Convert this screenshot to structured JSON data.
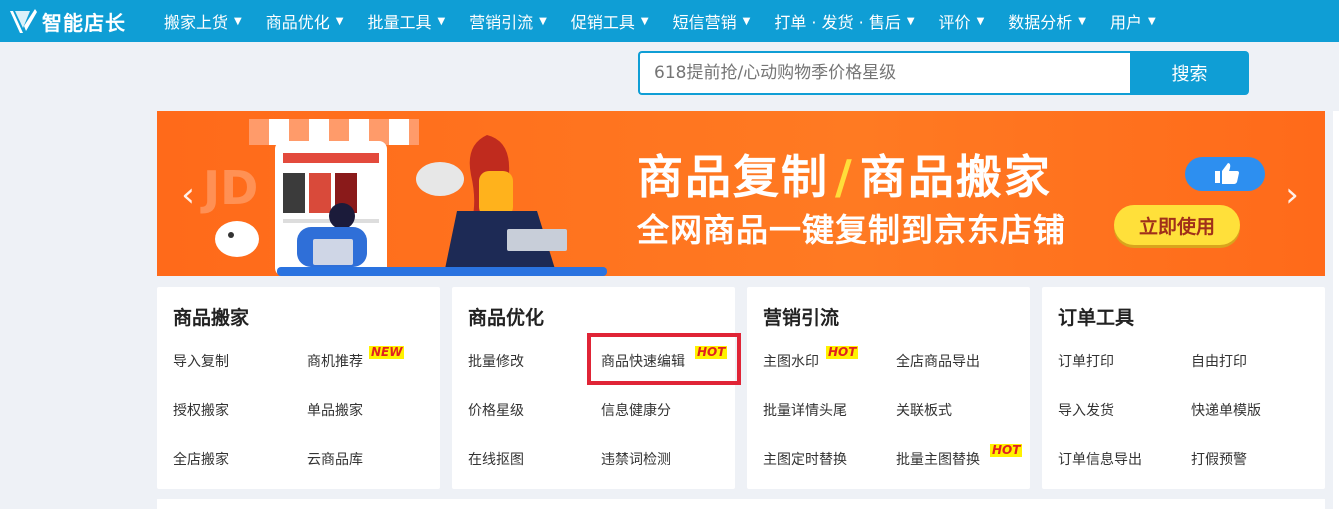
{
  "app": {
    "name": "智能店长"
  },
  "nav": {
    "items": [
      {
        "label": "搬家上货"
      },
      {
        "label": "商品优化"
      },
      {
        "label": "批量工具"
      },
      {
        "label": "营销引流"
      },
      {
        "label": "促销工具"
      },
      {
        "label": "短信营销"
      },
      {
        "label": "打单 · 发货 · 售后"
      },
      {
        "label": "评价"
      },
      {
        "label": "数据分析"
      },
      {
        "label": "用户"
      }
    ],
    "caret_icon": "caret-down-icon"
  },
  "search": {
    "placeholder": "618提前抢/心动购物季价格星级",
    "button_label": "搜索"
  },
  "banner": {
    "title_left": "商品复制",
    "title_sep": "/",
    "title_right": "商品搬家",
    "subtitle": "全网商品一键复制到京东店铺",
    "cta_label": "立即使用",
    "watermark": "JD",
    "prev_icon": "chevron-left-icon",
    "next_icon": "chevron-right-icon",
    "bg_color": "#ff6a1a",
    "cta_color": "#ffe03a"
  },
  "cards": [
    {
      "title": "商品搬家",
      "links": [
        {
          "label": "导入复制"
        },
        {
          "label": "商机推荐",
          "badge": "NEW"
        },
        {
          "label": "授权搬家"
        },
        {
          "label": "单品搬家"
        },
        {
          "label": "全店搬家"
        },
        {
          "label": "云商品库"
        }
      ]
    },
    {
      "title": "商品优化",
      "links": [
        {
          "label": "批量修改"
        },
        {
          "label": "商品快速编辑",
          "badge": "HOT"
        },
        {
          "label": "价格星级"
        },
        {
          "label": "信息健康分"
        },
        {
          "label": "在线抠图"
        },
        {
          "label": "违禁词检测"
        }
      ]
    },
    {
      "title": "营销引流",
      "links": [
        {
          "label": "主图水印",
          "badge": "HOT"
        },
        {
          "label": "全店商品导出"
        },
        {
          "label": "批量详情头尾"
        },
        {
          "label": "关联板式"
        },
        {
          "label": "主图定时替换"
        },
        {
          "label": "批量主图替换",
          "badge": "HOT"
        }
      ]
    },
    {
      "title": "订单工具",
      "links": [
        {
          "label": "订单打印"
        },
        {
          "label": "自由打印"
        },
        {
          "label": "导入发货"
        },
        {
          "label": "快递单模版"
        },
        {
          "label": "订单信息导出"
        },
        {
          "label": "打假预警"
        }
      ]
    }
  ],
  "colors": {
    "nav_bg": "#0f9ed5",
    "badge_bg": "#fff200",
    "badge_text": "#e02020",
    "highlight": "#e02436"
  }
}
